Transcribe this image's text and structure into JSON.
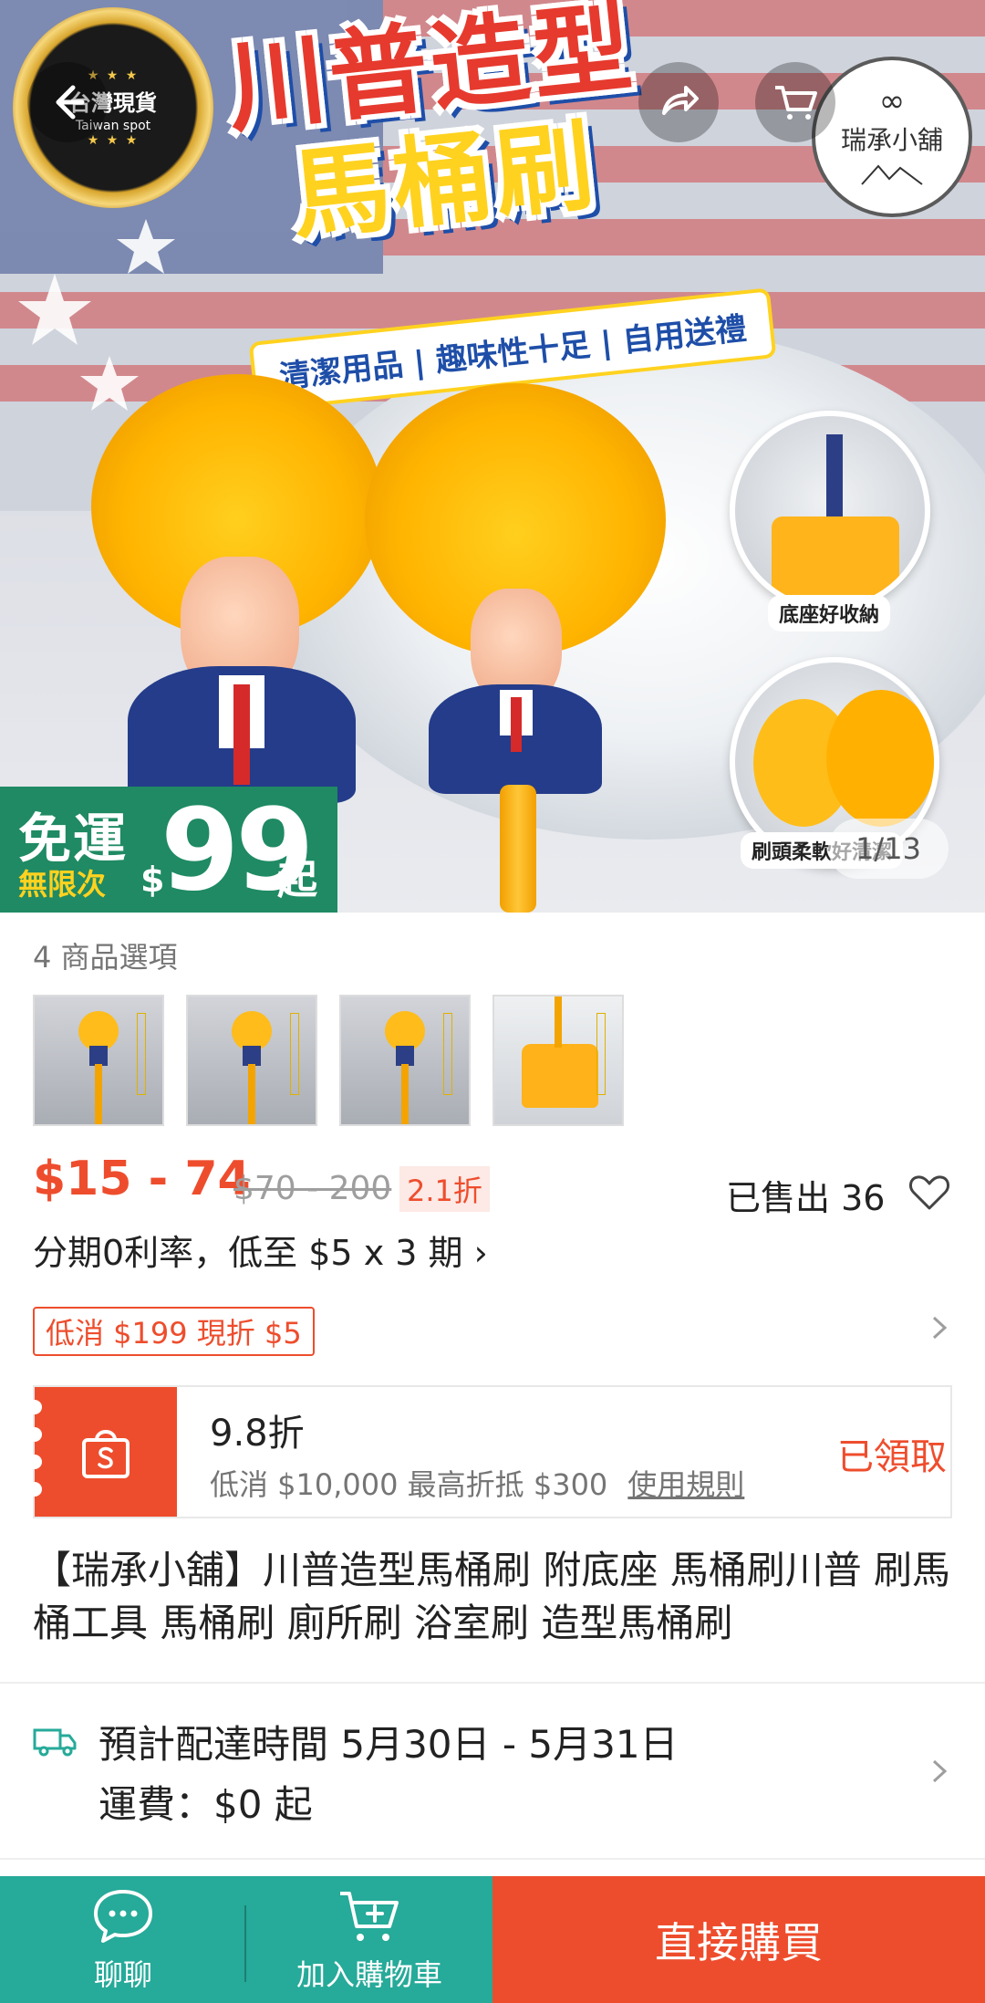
{
  "hero": {
    "stamp_cn": "台灣現貨",
    "stamp_en": "Taiwan spot",
    "title_line1": "川普造型",
    "title_line2": "馬桶刷",
    "tagline": "清潔用品 | 趣味性十足 | 自用送禮",
    "brand_badge": "瑞承小舖",
    "inset_top_label": "底座好收納",
    "inset_bottom_label": "刷頭柔軟好清潔",
    "promo_line1": "免運",
    "promo_line2": "無限次",
    "promo_currency": "$",
    "promo_amount": "99",
    "promo_suffix": "起",
    "image_counter": "1/13"
  },
  "options": {
    "label": "4 商品選項",
    "thumbnail_count": 4
  },
  "pricing": {
    "price_range": "$15 - 74",
    "original_range": "$70 - 200",
    "discount_badge": "2.1折",
    "sold": "已售出 36",
    "installment": "分期0利率，低至 $5 x 3 期 ›"
  },
  "voucher": {
    "label": "低消 $199 現折 $5"
  },
  "coupon": {
    "title": "9.8折",
    "description": "低消 $10,000 最高折抵 $300",
    "rules_link": "使用規則",
    "status": "已領取"
  },
  "product": {
    "title": "【瑞承小舖】川普造型馬桶刷 附底座 馬桶刷川普 刷馬桶工具 馬桶刷 廁所刷 浴室刷 造型馬桶刷"
  },
  "shipping": {
    "estimate": "預計配達時間 5月30日 - 5月31日",
    "fee": "運費：$0 起"
  },
  "bottom_bar": {
    "chat_label": "聊聊",
    "cart_label": "加入購物車",
    "buy_label": "直接購買"
  },
  "colors": {
    "accent": "#ee4d2d",
    "teal": "#26aa99",
    "promo_green": "#1f8a63"
  },
  "icons": [
    "back-arrow-icon",
    "share-icon",
    "cart-icon",
    "more-icon",
    "heart-icon",
    "chevron-right-icon",
    "shopee-bag-icon",
    "truck-icon",
    "chat-icon",
    "add-to-cart-icon"
  ]
}
